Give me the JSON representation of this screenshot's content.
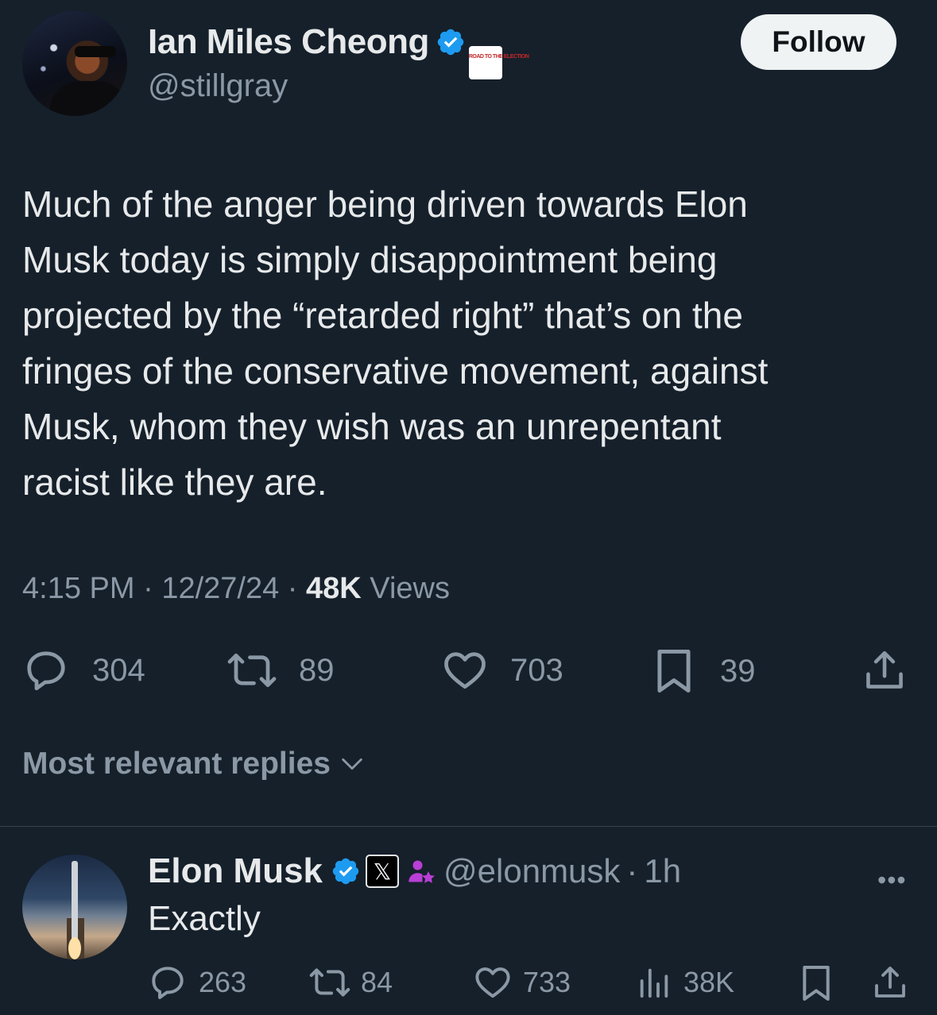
{
  "tweet": {
    "author": {
      "name": "Ian Miles Cheong",
      "handle": "@stillgray",
      "affiliation_badge": "ROAD TO THE ELECTION"
    },
    "follow_label": "Follow",
    "text": "Much of the anger being driven towards Elon\nMusk today is simply disappointment being\nprojected by the “retarded right” that’s on the\nfringes of the conservative movement, against\nMusk, whom they wish was an unrepentant\nracist like they are.",
    "time": "4:15 PM",
    "date": "12/27/24",
    "views_count": "48K",
    "views_label": "Views",
    "separator": "·",
    "stats": {
      "replies": "304",
      "reposts": "89",
      "likes": "703",
      "bookmarks": "39"
    }
  },
  "sort": {
    "label": "Most relevant replies"
  },
  "reply": {
    "name": "Elon Musk",
    "handle": "@elonmusk",
    "time": "1h",
    "separator": "·",
    "text": "Exactly",
    "stats": {
      "replies": "263",
      "reposts": "84",
      "likes": "733",
      "views": "38K"
    }
  },
  "colors": {
    "background": "#15202b",
    "text": "#e7e9ea",
    "secondary": "#8b98a5",
    "verified": "#1d9bf0"
  }
}
